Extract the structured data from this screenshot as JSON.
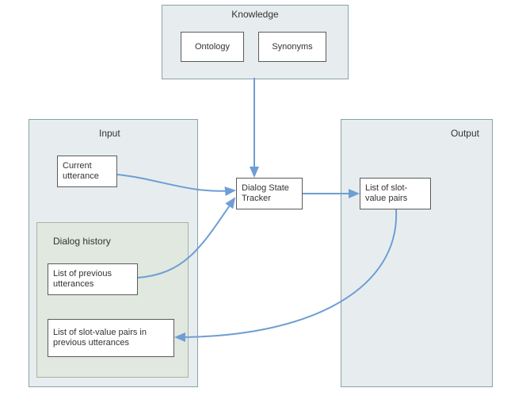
{
  "knowledge": {
    "title": "Knowledge",
    "ontology": "Ontology",
    "synonyms": "Synonyms"
  },
  "input": {
    "title": "Input",
    "current_utterance": "Current utterance",
    "history": {
      "title": "Dialog history",
      "prev_utterances": "List of previous utterances",
      "prev_slot_values": "List of slot-value pairs in previous utterances"
    }
  },
  "center": {
    "dst": "Dialog State Tracker"
  },
  "output": {
    "title": "Output",
    "slot_values": "List of slot-value pairs"
  },
  "caption": ""
}
